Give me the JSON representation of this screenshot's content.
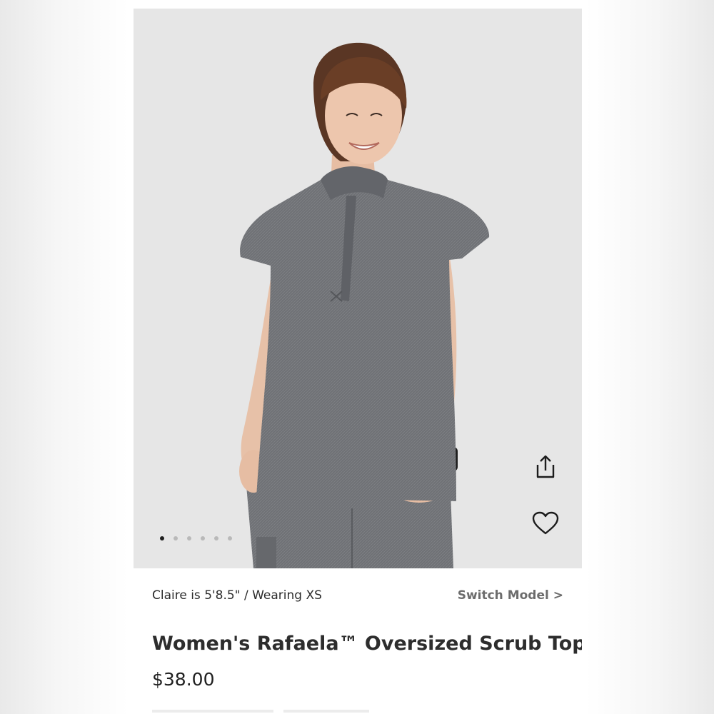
{
  "product_image": {
    "carousel_total": 6,
    "carousel_active_index": 0,
    "actions": {
      "share_icon": "share-icon",
      "favorite_icon": "heart-icon"
    }
  },
  "model": {
    "info": "Claire is 5'8.5\" / Wearing XS",
    "switch_label": "Switch Model >"
  },
  "product": {
    "title": "Women's Rafaela™ Oversized Scrub Top",
    "price": "$38.00"
  },
  "colors": {
    "garment": "#6f7175",
    "background": "#e6e6e6",
    "text_dark": "#2d2d2d",
    "text_muted": "#6c6c6c"
  }
}
